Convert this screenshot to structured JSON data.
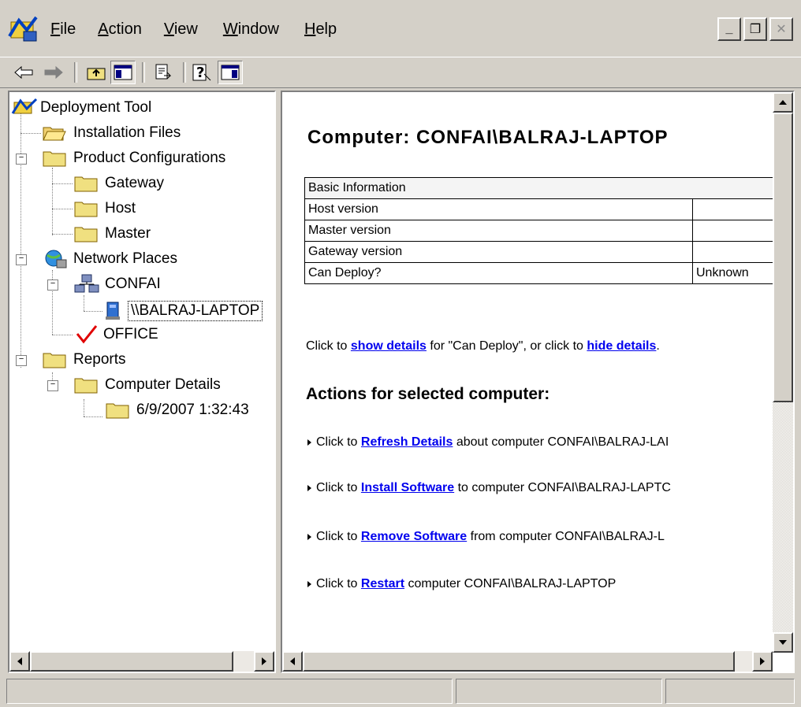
{
  "menu": {
    "items": [
      {
        "pre": "",
        "ul": "F",
        "post": "ile"
      },
      {
        "pre": "",
        "ul": "A",
        "post": "ction"
      },
      {
        "pre": "",
        "ul": "V",
        "post": "iew"
      },
      {
        "pre": "",
        "ul": "W",
        "post": "indow"
      },
      {
        "pre": "",
        "ul": "H",
        "post": "elp"
      }
    ]
  },
  "window_buttons": {
    "minimize": "_",
    "restore": "❐",
    "close": "✕"
  },
  "tree": {
    "root": "Deployment Tool",
    "installation_files": "Installation Files",
    "product_configurations": "Product Configurations",
    "gateway": "Gateway",
    "host": "Host",
    "master": "Master",
    "network_places": "Network Places",
    "confai": "CONFAI",
    "balraj_laptop": "\\\\BALRAJ-LAPTOP",
    "office": "OFFICE",
    "reports": "Reports",
    "computer_details": "Computer Details",
    "report_date": "6/9/2007 1:32:43"
  },
  "content": {
    "heading": "Computer: CONFAI\\BALRAJ-LAPTOP",
    "table": {
      "header": "Basic Information",
      "rows": [
        {
          "label": "Host version",
          "value": ""
        },
        {
          "label": "Master version",
          "value": ""
        },
        {
          "label": "Gateway version",
          "value": ""
        },
        {
          "label": "Can Deploy?",
          "value": "Unknown"
        }
      ]
    },
    "details_text": {
      "pre": "Click to ",
      "link1": "show details",
      "mid": " for \"Can Deploy\", or click to ",
      "link2": "hide details",
      "post": "."
    },
    "actions_title": "Actions for selected computer:",
    "actions": [
      {
        "pre": "Click to ",
        "link": "Refresh Details",
        "post": " about computer CONFAI\\BALRAJ-LAI"
      },
      {
        "pre": "Click to ",
        "link": "Install Software",
        "post": " to computer CONFAI\\BALRAJ-LAPTC"
      },
      {
        "pre": "Click to ",
        "link": "Remove Software",
        "post": " from computer CONFAI\\BALRAJ-L"
      },
      {
        "pre": "Click to ",
        "link": "Restart",
        "post": " computer CONFAI\\BALRAJ-LAPTOP"
      }
    ]
  },
  "colors": {
    "link": "#0000ee",
    "chrome": "#d4d0c8",
    "check": "#e00000"
  }
}
